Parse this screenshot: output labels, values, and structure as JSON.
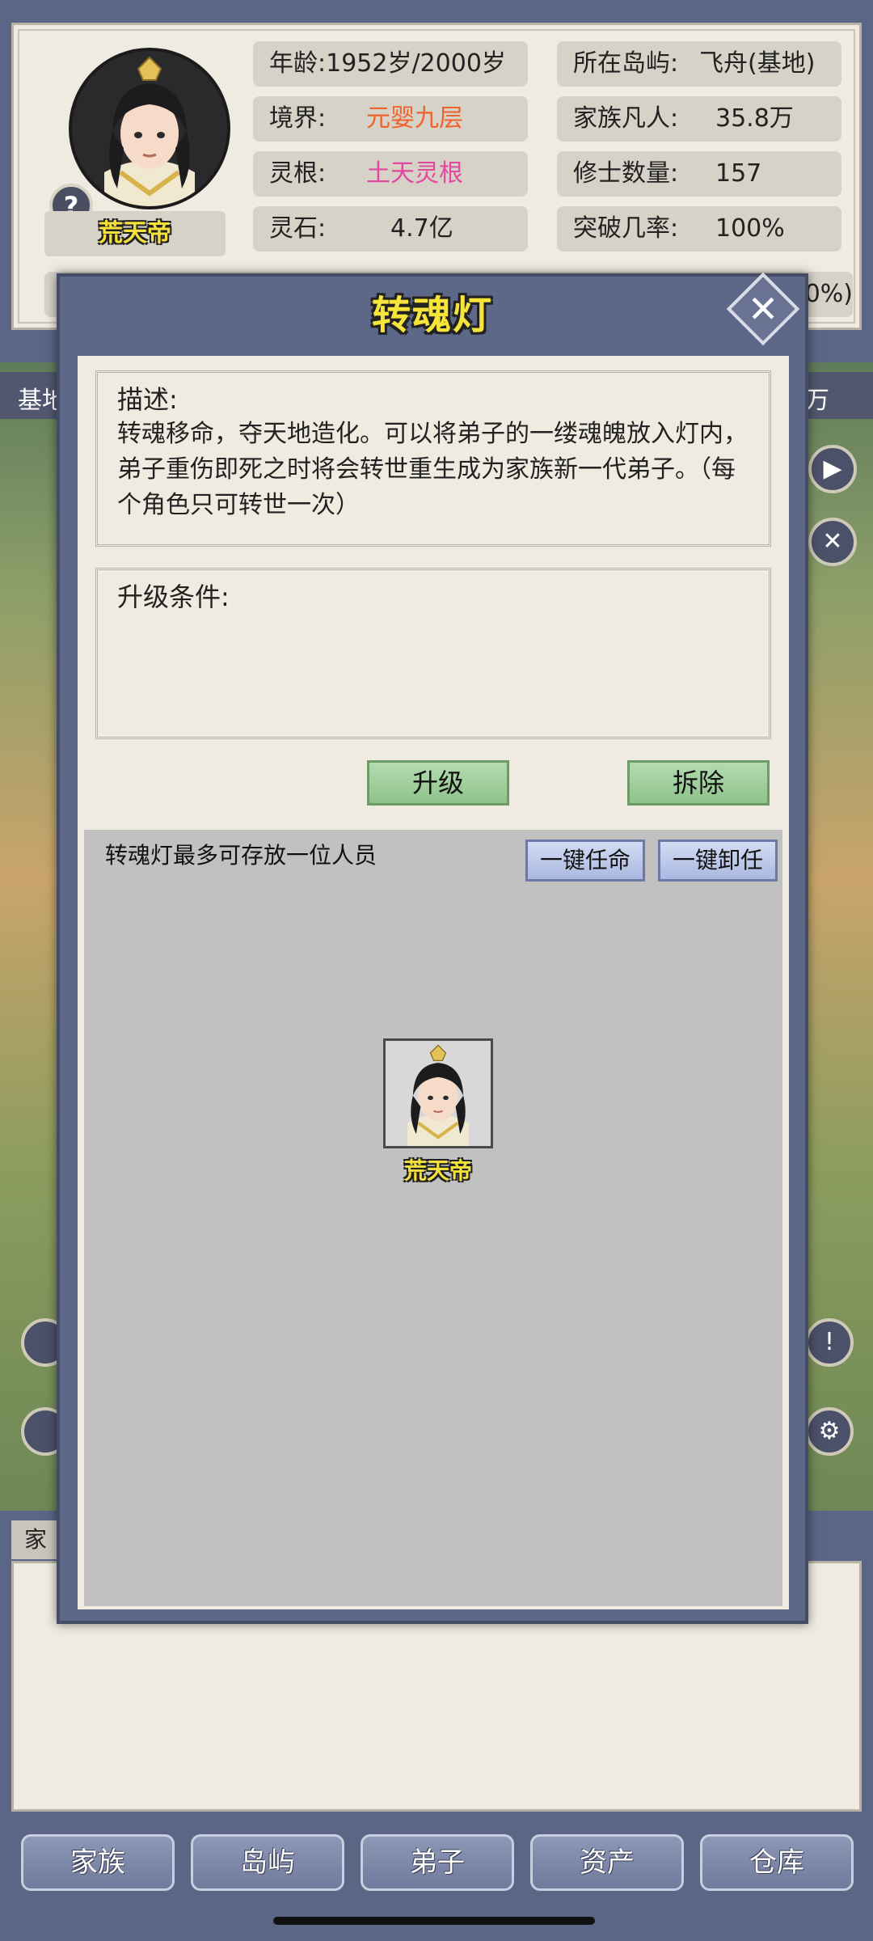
{
  "top_panel": {
    "character_name": "荒天帝",
    "help_icon_glyph": "?",
    "stats": [
      {
        "label": "年龄:1952岁/2000岁",
        "value": "",
        "value_color": "#222222"
      },
      {
        "label": "所在岛屿:",
        "value": "飞舟(基地)",
        "value_color": "#222222"
      },
      {
        "label": "境界:",
        "value": "元婴九层",
        "value_color": "#f0622b"
      },
      {
        "label": "家族凡人:",
        "value": "35.8万",
        "value_color": "#222222"
      },
      {
        "label": "灵根:",
        "value": "土天灵根",
        "value_color": "#e447a0"
      },
      {
        "label": "修士数量:",
        "value": "157",
        "value_color": "#222222"
      },
      {
        "label": "灵石:",
        "value": "4.7亿",
        "value_color": "#222222"
      },
      {
        "label": "突破几率:",
        "value": "100%",
        "value_color": "#222222"
      }
    ],
    "partial_stat_right": "0%)"
  },
  "map": {
    "left_label": "基地",
    "right_label": "万"
  },
  "modal": {
    "title": "转魂灯",
    "close_glyph": "✕",
    "description_label": "描述:",
    "description_text": "转魂移命，夺天地造化。可以将弟子的一缕魂魄放入灯内，弟子重伤即死之时将会转世重生成为家族新一代弟子。（每个角色只可转世一次）",
    "upgrade_label": "升级条件:",
    "upgrade_button": "升级",
    "dismantle_button": "拆除",
    "capacity_text": "转魂灯最多可存放一位人员",
    "appoint_all_button": "一键任命",
    "dismiss_all_button": "一键卸任",
    "slot_name": "荒天帝"
  },
  "log_panel": {
    "tab_label": "家"
  },
  "bottom_nav": {
    "items": [
      "家族",
      "岛屿",
      "弟子",
      "资产",
      "仓库"
    ]
  },
  "colors": {
    "accent_yellow": "#f6e43b",
    "modal_frame": "#5d6788",
    "panel_bg": "#efebe1"
  }
}
